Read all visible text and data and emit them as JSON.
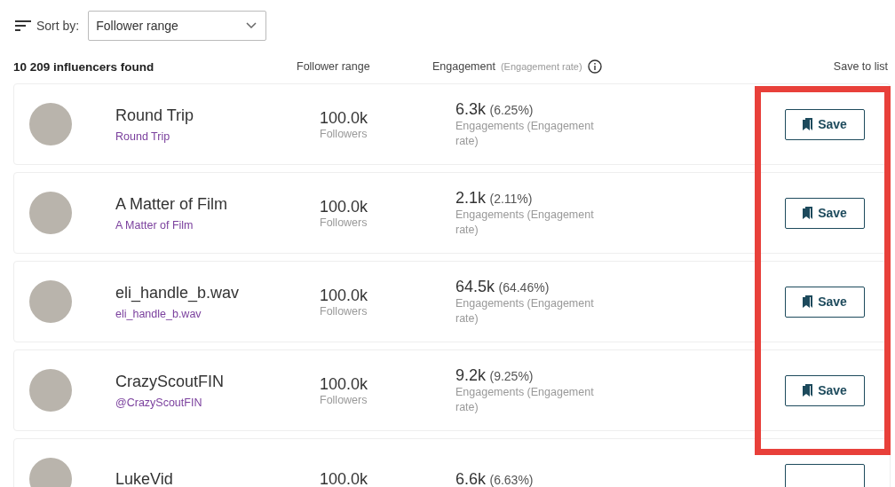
{
  "sort": {
    "label": "Sort by:",
    "value": "Follower range"
  },
  "results_count": "10 209 influencers found",
  "columns": {
    "followers": "Follower range",
    "engagement": "Engagement",
    "engagement_hint": "(Engagement rate)",
    "save": "Save to list"
  },
  "influencers": [
    {
      "name": "Round Trip",
      "handle": "Round Trip",
      "followers": "100.0k",
      "followers_label": "Followers",
      "engagements": "6.3k",
      "rate": "(6.25%)",
      "engagement_label": "Engagements (Engagement rate)",
      "save_label": "Save"
    },
    {
      "name": "A Matter of Film",
      "handle": "A Matter of Film",
      "followers": "100.0k",
      "followers_label": "Followers",
      "engagements": "2.1k",
      "rate": "(2.11%)",
      "engagement_label": "Engagements (Engagement rate)",
      "save_label": "Save"
    },
    {
      "name": "eli_handle_b.wav",
      "handle": "eli_handle_b.wav",
      "followers": "100.0k",
      "followers_label": "Followers",
      "engagements": "64.5k",
      "rate": "(64.46%)",
      "engagement_label": "Engagements (Engagement rate)",
      "save_label": "Save"
    },
    {
      "name": "CrazyScoutFIN",
      "handle": "@CrazyScoutFIN",
      "followers": "100.0k",
      "followers_label": "Followers",
      "engagements": "9.2k",
      "rate": "(9.25%)",
      "engagement_label": "Engagements (Engagement rate)",
      "save_label": "Save"
    },
    {
      "name": "LukeVid",
      "followers": "100.0k",
      "engagements": "6.6k",
      "rate": "(6.63%)"
    }
  ]
}
